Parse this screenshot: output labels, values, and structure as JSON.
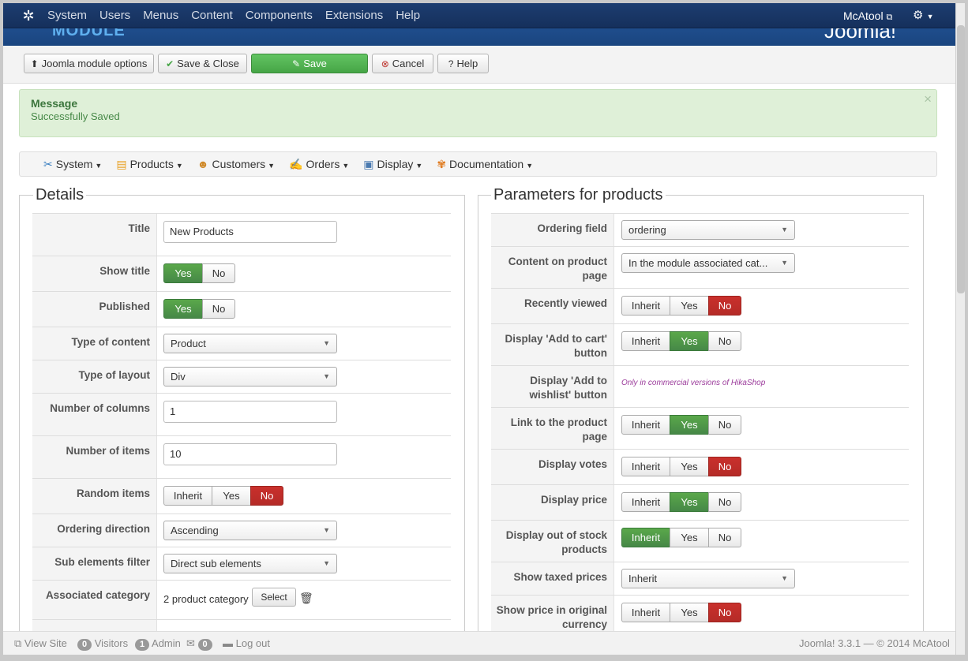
{
  "topnav": {
    "menu": [
      "System",
      "Users",
      "Menus",
      "Content",
      "Components",
      "Extensions",
      "Help"
    ],
    "user": "McAtool"
  },
  "banner": {
    "title": "MODULE",
    "brand": "Joomla!"
  },
  "toolbar": {
    "options": "Joomla module options",
    "save_close": "Save & Close",
    "save": "Save",
    "cancel": "Cancel",
    "help": "Help"
  },
  "message": {
    "heading": "Message",
    "body": "Successfully Saved",
    "close": "×"
  },
  "hikamenu": [
    "System",
    "Products",
    "Customers",
    "Orders",
    "Display",
    "Documentation"
  ],
  "details": {
    "legend": "Details",
    "title_label": "Title",
    "title_value": "New Products",
    "show_title_label": "Show title",
    "published_label": "Published",
    "type_content_label": "Type of content",
    "type_content_value": "Product",
    "type_layout_label": "Type of layout",
    "type_layout_value": "Div",
    "columns_label": "Number of columns",
    "columns_value": "1",
    "items_label": "Number of items",
    "items_value": "10",
    "random_label": "Random items",
    "ordering_dir_label": "Ordering direction",
    "ordering_dir_value": "Ascending",
    "sub_filter_label": "Sub elements filter",
    "sub_filter_value": "Direct sub elements",
    "assoc_cat_label": "Associated category",
    "assoc_cat_value": "2 product category",
    "select_btn": "Select"
  },
  "params": {
    "legend": "Parameters for products",
    "ordering_field_label": "Ordering field",
    "ordering_field_value": "ordering",
    "content_page_label": "Content on product page",
    "content_page_value": "In the module associated cat...",
    "recently_label": "Recently viewed",
    "add_cart_label": "Display 'Add to cart' button",
    "wishlist_label": "Display 'Add to wishlist' button",
    "wishlist_note": "Only in commercial versions of HikaShop",
    "link_label": "Link to the product page",
    "votes_label": "Display votes",
    "price_label": "Display price",
    "stock_label": "Display out of stock products",
    "taxed_label": "Show taxed prices",
    "taxed_value": "Inherit",
    "original_label": "Show price in original currency"
  },
  "toggles": {
    "yes": "Yes",
    "no": "No",
    "inherit": "Inherit"
  },
  "footer": {
    "view_site": "View Site",
    "visitors_count": "0",
    "visitors": "Visitors",
    "admin_count": "1",
    "admin": "Admin",
    "mail_count": "0",
    "logout": "Log out",
    "version": "Joomla! 3.3.1 — © 2014 McAtool"
  }
}
